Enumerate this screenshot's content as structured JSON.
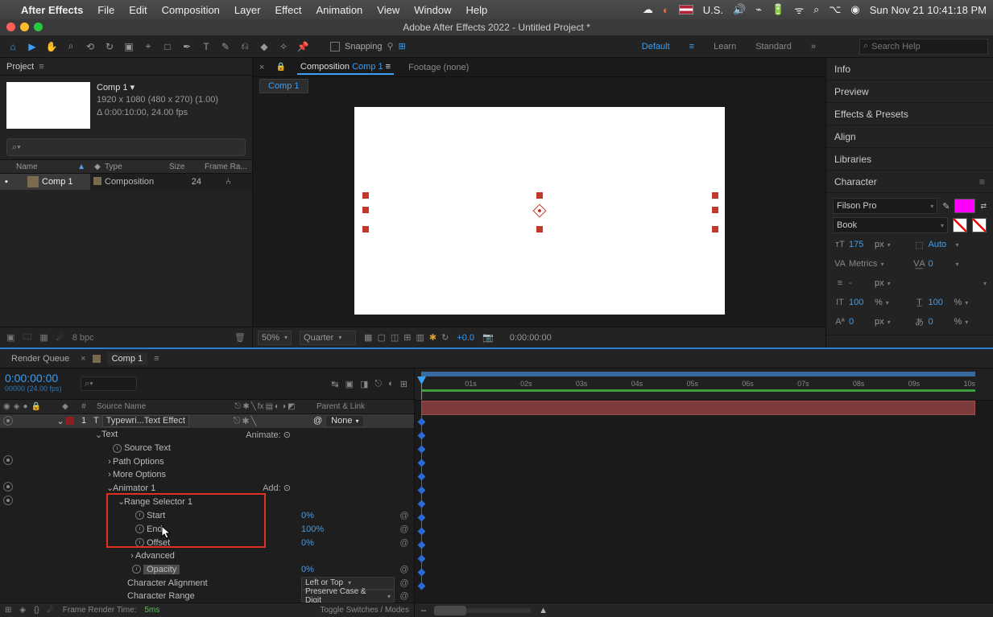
{
  "mac_menu": {
    "app": "After Effects",
    "items": [
      "File",
      "Edit",
      "Composition",
      "Layer",
      "Effect",
      "Animation",
      "View",
      "Window",
      "Help"
    ],
    "locale": "U.S.",
    "clock": "Sun Nov 21  10:41:18 PM"
  },
  "window_title": "Adobe After Effects 2022 - Untitled Project *",
  "toolbar": {
    "snapping": "Snapping",
    "workspaces": [
      "Default",
      "Learn",
      "Standard"
    ],
    "active_workspace": "Default",
    "search_placeholder": "Search Help"
  },
  "project": {
    "tab": "Project",
    "comp_name": "Comp 1",
    "meta_line1": "1920 x 1080  (480 x 270) (1.00)",
    "meta_line2": "Δ 0:00:10:00, 24.00 fps",
    "columns": {
      "name": "Name",
      "type": "Type",
      "size": "Size",
      "frame": "Frame Ra..."
    },
    "row": {
      "name": "Comp 1",
      "type": "Composition",
      "size": "24"
    },
    "bpc": "8 bpc"
  },
  "center": {
    "tab_prefix": "Composition",
    "tab_comp": "Comp 1",
    "footage": "Footage (none)",
    "subtab": "Comp 1",
    "zoom": "50%",
    "res": "Quarter",
    "exposure": "+0.0",
    "time": "0:00:00:00"
  },
  "right_panels": [
    "Info",
    "Preview",
    "Effects & Presets",
    "Align",
    "Libraries"
  ],
  "character": {
    "title": "Character",
    "font": "Filson Pro",
    "style": "Book",
    "size": "175",
    "size_unit": "px",
    "leading": "Auto",
    "kerning": "Metrics",
    "tracking": "0",
    "stroke": "-",
    "stroke_unit": "px",
    "vscale": "100",
    "hscale": "100",
    "baseline": "0",
    "baseline_unit": "px",
    "tsume": "0",
    "pct": "%"
  },
  "timeline": {
    "tabs": {
      "rq": "Render Queue",
      "comp": "Comp 1"
    },
    "time": "0:00:00:00",
    "frame_info": "00000 (24.00 fps)",
    "cols": {
      "hash": "#",
      "source": "Source Name",
      "parent": "Parent & Link"
    },
    "layer": {
      "num": "1",
      "name": "Typewri...Text Effect",
      "parent": "None"
    },
    "props": {
      "text": "Text",
      "animate": "Animate:",
      "source_text": "Source Text",
      "path_options": "Path Options",
      "more_options": "More Options",
      "animator": "Animator 1",
      "add": "Add:",
      "range_selector": "Range Selector 1",
      "start": "Start",
      "start_val": "0",
      "end": "End",
      "end_val": "100",
      "offset": "Offset",
      "offset_val": "0",
      "advanced": "Advanced",
      "opacity": "Opacity",
      "opacity_val": "0",
      "char_align": "Character Alignment",
      "char_align_val": "Left or Top",
      "char_range": "Character Range",
      "char_range_val": "Preserve Case & Digit",
      "pct": "%"
    },
    "footer": {
      "toggle": "Toggle Switches / Modes",
      "frt_label": "Frame Render Time:",
      "frt_val": "5ms"
    },
    "ruler": [
      "",
      "01s",
      "02s",
      "03s",
      "04s",
      "05s",
      "06s",
      "07s",
      "08s",
      "09s",
      "10s"
    ]
  }
}
